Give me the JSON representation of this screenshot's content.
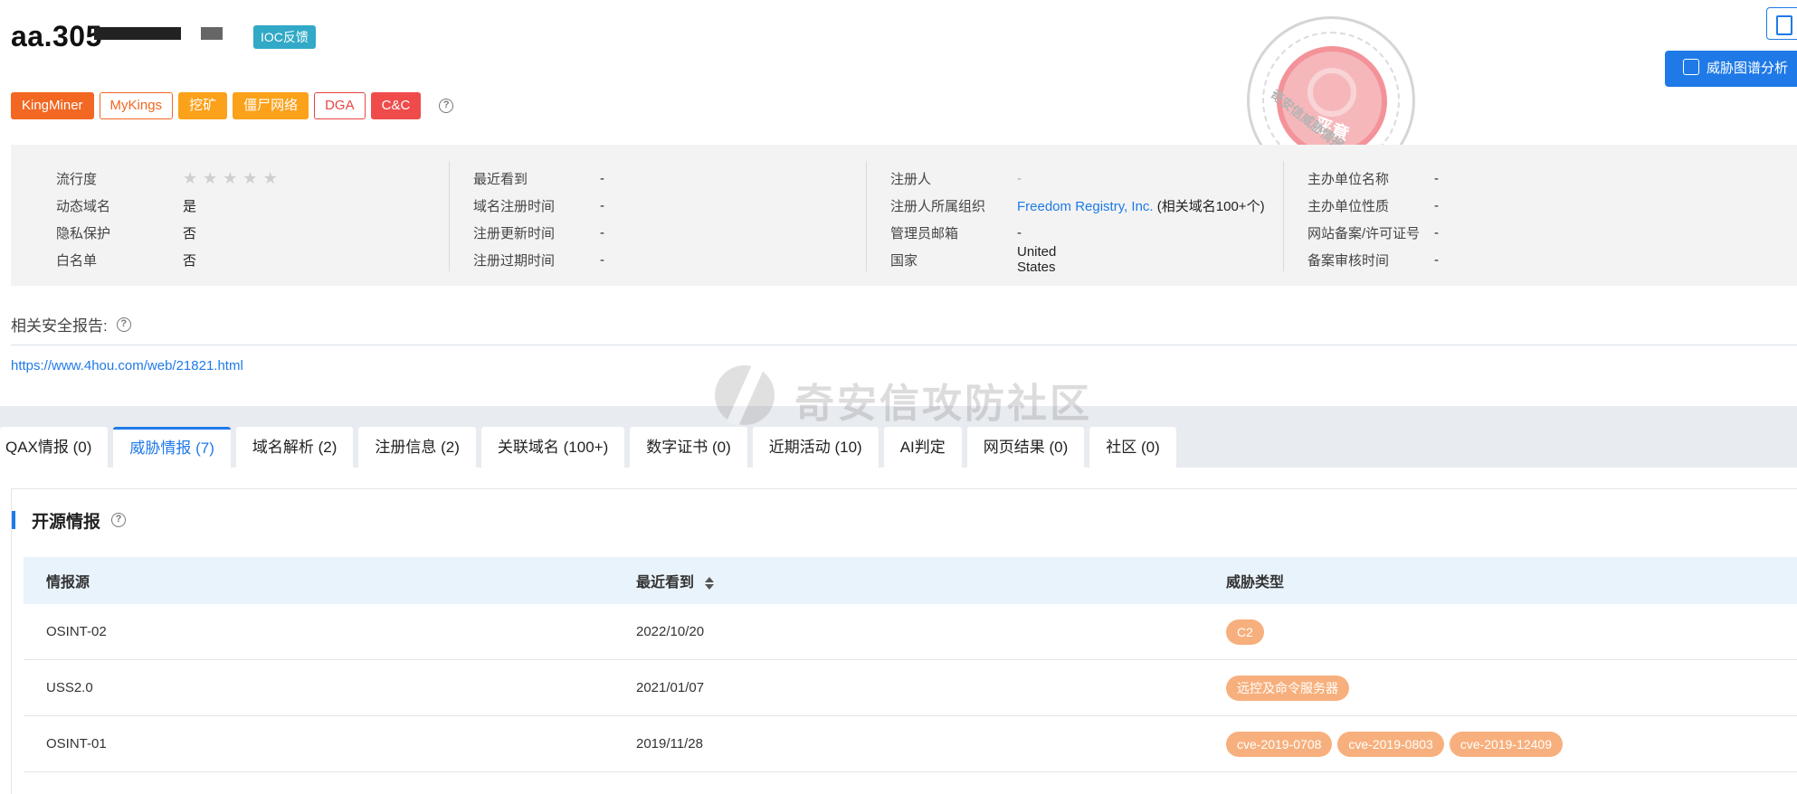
{
  "header": {
    "domain": "aa.305",
    "ioc_button": "IOC反馈",
    "analysis_button": "威胁图谱分析"
  },
  "stamp": {
    "label": "恶意",
    "arc_text": "奇安信威胁情报中心"
  },
  "tags": [
    {
      "label": "KingMiner",
      "style": "fill-orange"
    },
    {
      "label": "MyKings",
      "style": "line-orange"
    },
    {
      "label": "挖矿",
      "style": "fill-amber"
    },
    {
      "label": "僵尸网络",
      "style": "fill-amber"
    },
    {
      "label": "DGA",
      "style": "line-red"
    },
    {
      "label": "C&C",
      "style": "fill-red"
    }
  ],
  "info": {
    "popularity_label": "流行度",
    "popularity_stars": 0,
    "popularity_max": 5,
    "col1": [
      {
        "label": "动态域名",
        "value": "是"
      },
      {
        "label": "隐私保护",
        "value": "否"
      },
      {
        "label": "白名单",
        "value": "否"
      }
    ],
    "col2": [
      {
        "label": "最近看到",
        "value": "-"
      },
      {
        "label": "域名注册时间",
        "value": "-"
      },
      {
        "label": "注册更新时间",
        "value": "-"
      },
      {
        "label": "注册过期时间",
        "value": "-"
      }
    ],
    "col3": {
      "registrant_label": "注册人",
      "registrant_value": "-",
      "org_label": "注册人所属组织",
      "org_value": "Freedom Registry, Inc.",
      "org_extra": "(相关域名100+个)",
      "email_label": "管理员邮箱",
      "email_value": "-",
      "country_label": "国家",
      "country_value": "United States"
    },
    "col4": [
      {
        "label": "主办单位名称",
        "value": "-"
      },
      {
        "label": "主办单位性质",
        "value": "-"
      },
      {
        "label": "网站备案/许可证号",
        "value": "-"
      },
      {
        "label": "备案审核时间",
        "value": "-"
      }
    ]
  },
  "report": {
    "label": "相关安全报告:",
    "link": "https://www.4hou.com/web/21821.html"
  },
  "watermark": "奇安信攻防社区",
  "tabs": [
    {
      "label": "QAX情报 (0)",
      "active": false
    },
    {
      "label": "威胁情报 (7)",
      "active": true
    },
    {
      "label": "域名解析 (2)",
      "active": false
    },
    {
      "label": "注册信息 (2)",
      "active": false
    },
    {
      "label": "关联域名 (100+)",
      "active": false
    },
    {
      "label": "数字证书 (0)",
      "active": false
    },
    {
      "label": "近期活动 (10)",
      "active": false
    },
    {
      "label": "AI判定",
      "active": false
    },
    {
      "label": "网页结果 (0)",
      "active": false
    },
    {
      "label": "社区 (0)",
      "active": false
    }
  ],
  "section": {
    "title": "开源情报"
  },
  "table": {
    "headers": [
      "情报源",
      "最近看到",
      "威胁类型"
    ],
    "rows": [
      {
        "source": "OSINT-02",
        "seen": "2022/10/20",
        "types": [
          "C2"
        ]
      },
      {
        "source": "USS2.0",
        "seen": "2021/01/07",
        "types": [
          "远控及命令服务器"
        ]
      },
      {
        "source": "OSINT-01",
        "seen": "2019/11/28",
        "types": [
          "cve-2019-0708",
          "cve-2019-0803",
          "cve-2019-12409"
        ]
      }
    ]
  }
}
